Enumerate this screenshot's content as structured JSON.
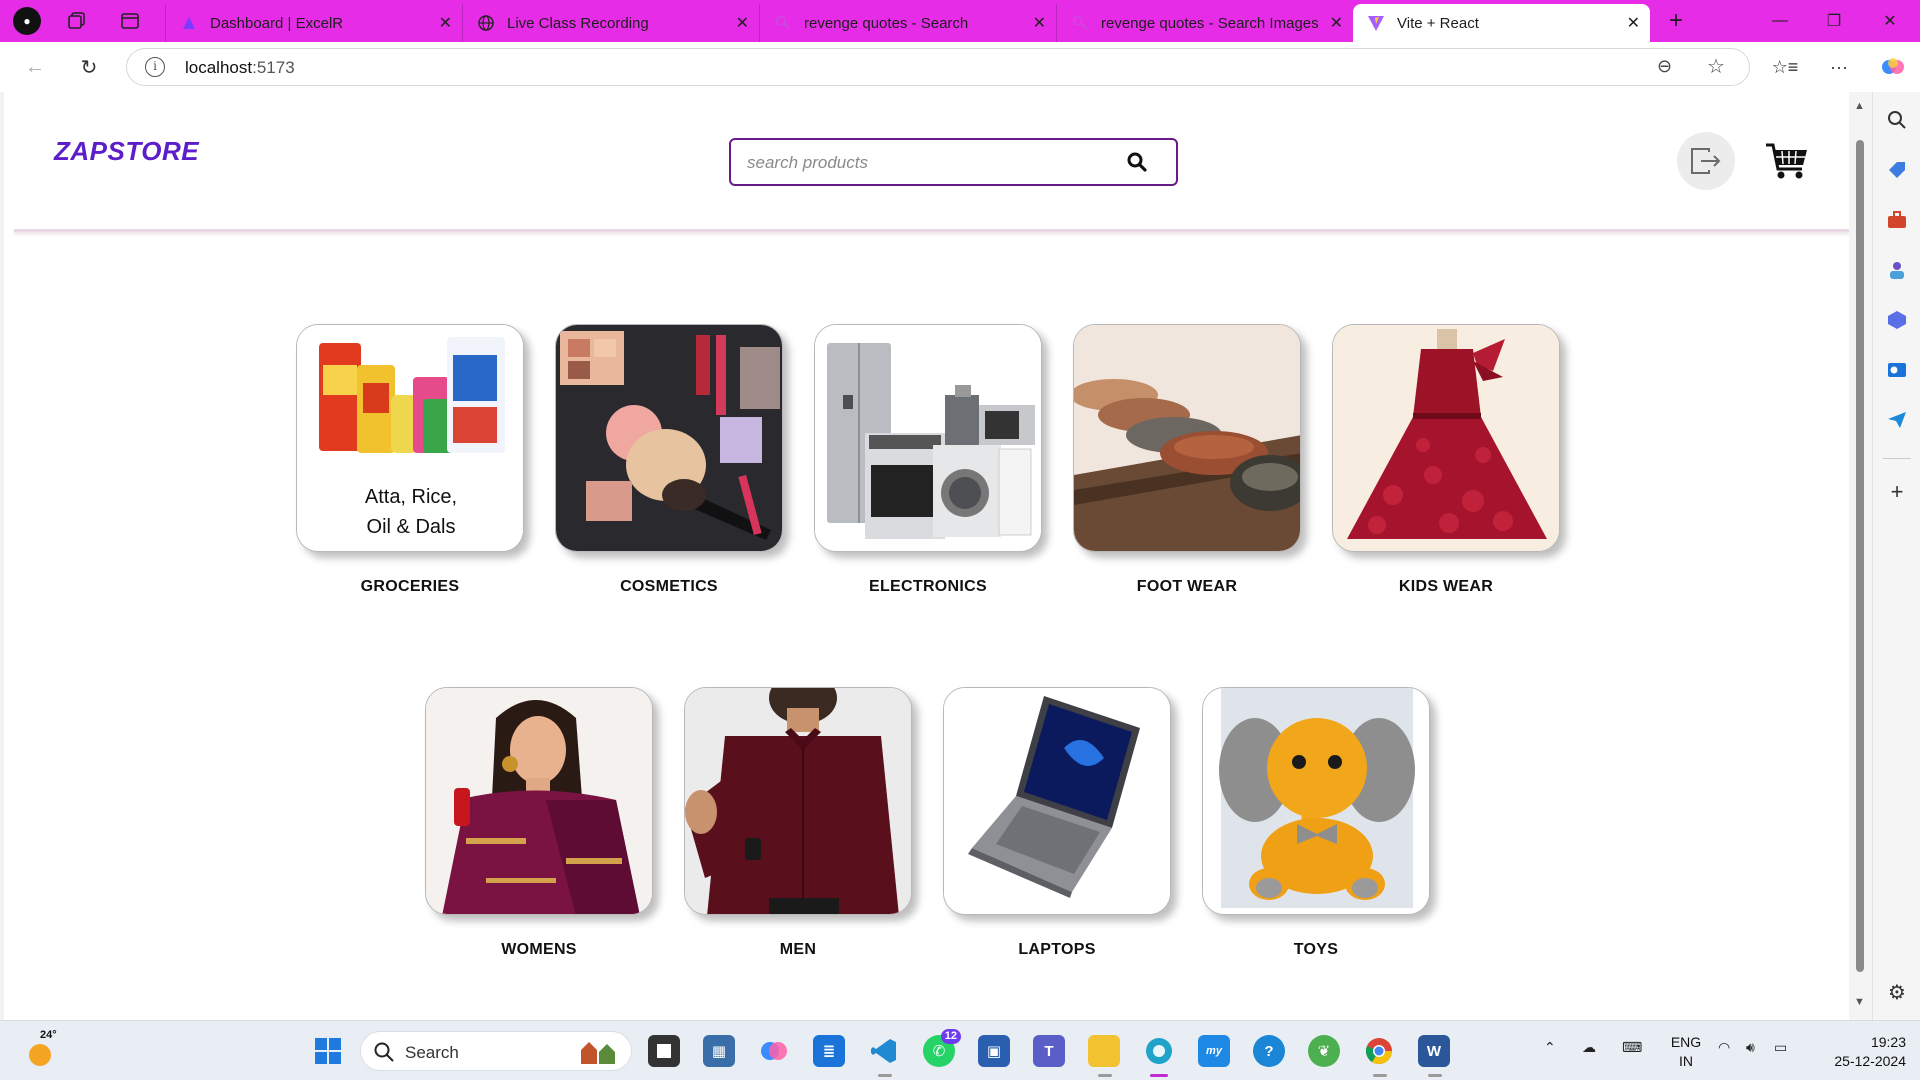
{
  "browser": {
    "tabs": [
      {
        "title": "Dashboard | ExcelR",
        "active": false
      },
      {
        "title": "Live Class Recording",
        "active": false
      },
      {
        "title": "revenge quotes - Search",
        "active": false
      },
      {
        "title": "revenge quotes - Search Images",
        "active": false
      },
      {
        "title": "Vite + React",
        "active": true
      }
    ],
    "url_host": "localhost",
    "url_port": ":5173",
    "accent_color": "#e62ce6"
  },
  "site": {
    "logo": "ZAPSTORE",
    "search_placeholder": "search products",
    "brand_color": "#5b1ec9"
  },
  "categories": [
    {
      "label": "GROCERIES",
      "card_text_1": "Atta, Rice,",
      "card_text_2": "Oil & Dals",
      "image": "groceries"
    },
    {
      "label": "COSMETICS",
      "image": "cosmetics"
    },
    {
      "label": "ELECTRONICS",
      "image": "electronics"
    },
    {
      "label": "FOOT WEAR",
      "image": "shoes"
    },
    {
      "label": "KIDS WEAR",
      "image": "kids-dress"
    },
    {
      "label": "WOMENS",
      "image": "saree"
    },
    {
      "label": "MEN",
      "image": "shirt"
    },
    {
      "label": "LAPTOPS",
      "image": "laptop"
    },
    {
      "label": "TOYS",
      "image": "elephant-toy"
    }
  ],
  "taskbar": {
    "weather_temp": "24°",
    "search_label": "Search",
    "whatsapp_badge": "12",
    "lang_1": "ENG",
    "lang_2": "IN",
    "time": "19:23",
    "date": "25-12-2024"
  }
}
